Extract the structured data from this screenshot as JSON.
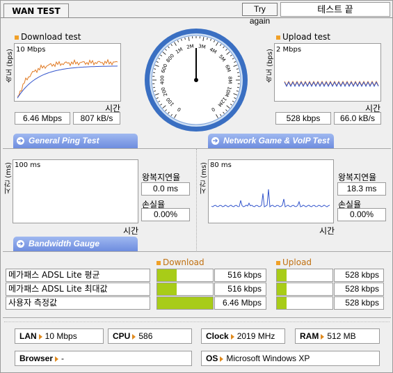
{
  "header": {
    "tab_label": "WAN TEST",
    "try_again": "Try again",
    "status": "테스트 끝"
  },
  "download": {
    "title": "Download test",
    "ylabel": "속도 (bps)",
    "scale": "10 Mbps",
    "xlabel": "시간",
    "speed": "6.46 Mbps",
    "bytes": "807 kB/s"
  },
  "upload": {
    "title": "Upload test",
    "ylabel": "속도 (bps)",
    "scale": "2 Mbps",
    "xlabel": "시간",
    "speed": "528 kbps",
    "bytes": "66.0 kB/s"
  },
  "gauge": {
    "labels": [
      "0",
      "100",
      "200",
      "400",
      "600",
      "800",
      "1M",
      "2M",
      "3M",
      "4M",
      "5M",
      "6M",
      "8M",
      "10M",
      "12M",
      "0"
    ],
    "current_value": "0"
  },
  "ping": {
    "tab": "General Ping Test",
    "ylabel": "시간 (ms)",
    "scale": "100 ms",
    "xlabel": "시간",
    "rtt_label": "왕복지연율",
    "rtt": "0.0 ms",
    "loss_label": "손실율",
    "loss": "0.00%"
  },
  "game": {
    "tab": "Network Game & VoIP Test",
    "ylabel": "시간 (ms)",
    "scale": "80 ms",
    "xlabel": "시간",
    "rtt_label": "왕복지연율",
    "rtt": "18.3 ms",
    "loss_label": "손실율",
    "loss": "0.00%"
  },
  "bandwidth": {
    "tab": "Bandwidth Gauge",
    "download_label": "Download",
    "upload_label": "Upload",
    "rows": [
      {
        "label": "메가패스 ADSL Lite 평균",
        "download": "516 kbps",
        "download_fill": 0.35,
        "upload": "528 kbps",
        "upload_fill": 0.17
      },
      {
        "label": "메가패스 ADSL Lite 최대값",
        "download": "516 kbps",
        "download_fill": 0.35,
        "upload": "528 kbps",
        "upload_fill": 0.17
      },
      {
        "label": "사용자 측정값",
        "download": "6.46 Mbps",
        "download_fill": 1.0,
        "upload": "528 kbps",
        "upload_fill": 0.17
      }
    ]
  },
  "system": {
    "lan_label": "LAN",
    "lan": "10 Mbps",
    "cpu_label": "CPU",
    "cpu": "586",
    "clock_label": "Clock",
    "clock": "2019 MHz",
    "ram_label": "RAM",
    "ram": "512 MB",
    "browser_label": "Browser",
    "browser": "-",
    "os_label": "OS",
    "os": "Microsoft Windows XP"
  },
  "colors": {
    "accent_orange": "#f0a028",
    "bar_green": "#a8cc18",
    "line_blue": "#3355cc",
    "tab_blue": "#6e8ddf"
  }
}
